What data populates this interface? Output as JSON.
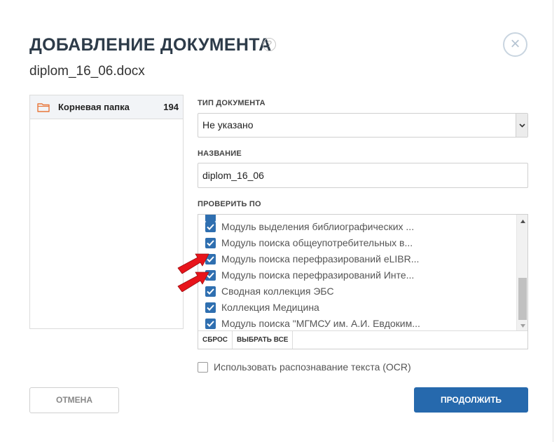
{
  "dialog": {
    "title": "ДОБАВЛЕНИЕ ДОКУМЕНТА",
    "help_icon": "?",
    "filename": "diplom_16_06.docx",
    "close_icon": "×"
  },
  "folder_tree": {
    "items": [
      {
        "label": "Корневая папка",
        "count": "194",
        "icon": "folder-icon"
      }
    ]
  },
  "doc_type": {
    "label": "ТИП ДОКУМЕНТА",
    "value": "Не указано"
  },
  "name": {
    "label": "НАЗВАНИЕ",
    "value": "diplom_16_06"
  },
  "check_by": {
    "label": "ПРОВЕРИТЬ ПО",
    "items": [
      {
        "label": "Модуль выделения библиографических ...",
        "checked": true
      },
      {
        "label": "Модуль поиска общеупотребительных в...",
        "checked": true
      },
      {
        "label": "Модуль поиска перефразирований eLIBR...",
        "checked": true
      },
      {
        "label": "Модуль поиска перефразирований Инте...",
        "checked": true
      },
      {
        "label": "Сводная коллекция ЭБС",
        "checked": true
      },
      {
        "label": "Коллекция Медицина",
        "checked": true
      },
      {
        "label": "Модуль поиска \"МГМСУ им. А.И. Евдоким...",
        "checked": true
      }
    ],
    "reset_label": "СБРОС",
    "select_all_label": "ВЫБРАТЬ ВСЕ"
  },
  "ocr": {
    "label": "Использовать распознавание текста (OCR)",
    "checked": false
  },
  "buttons": {
    "cancel": "ОТМЕНА",
    "continue": "ПРОДОЛЖИТЬ"
  },
  "colors": {
    "primary": "#2669ad",
    "checkbox": "#2f6fb0",
    "title": "#2d3b49",
    "annotation_arrow": "#e8141b"
  }
}
